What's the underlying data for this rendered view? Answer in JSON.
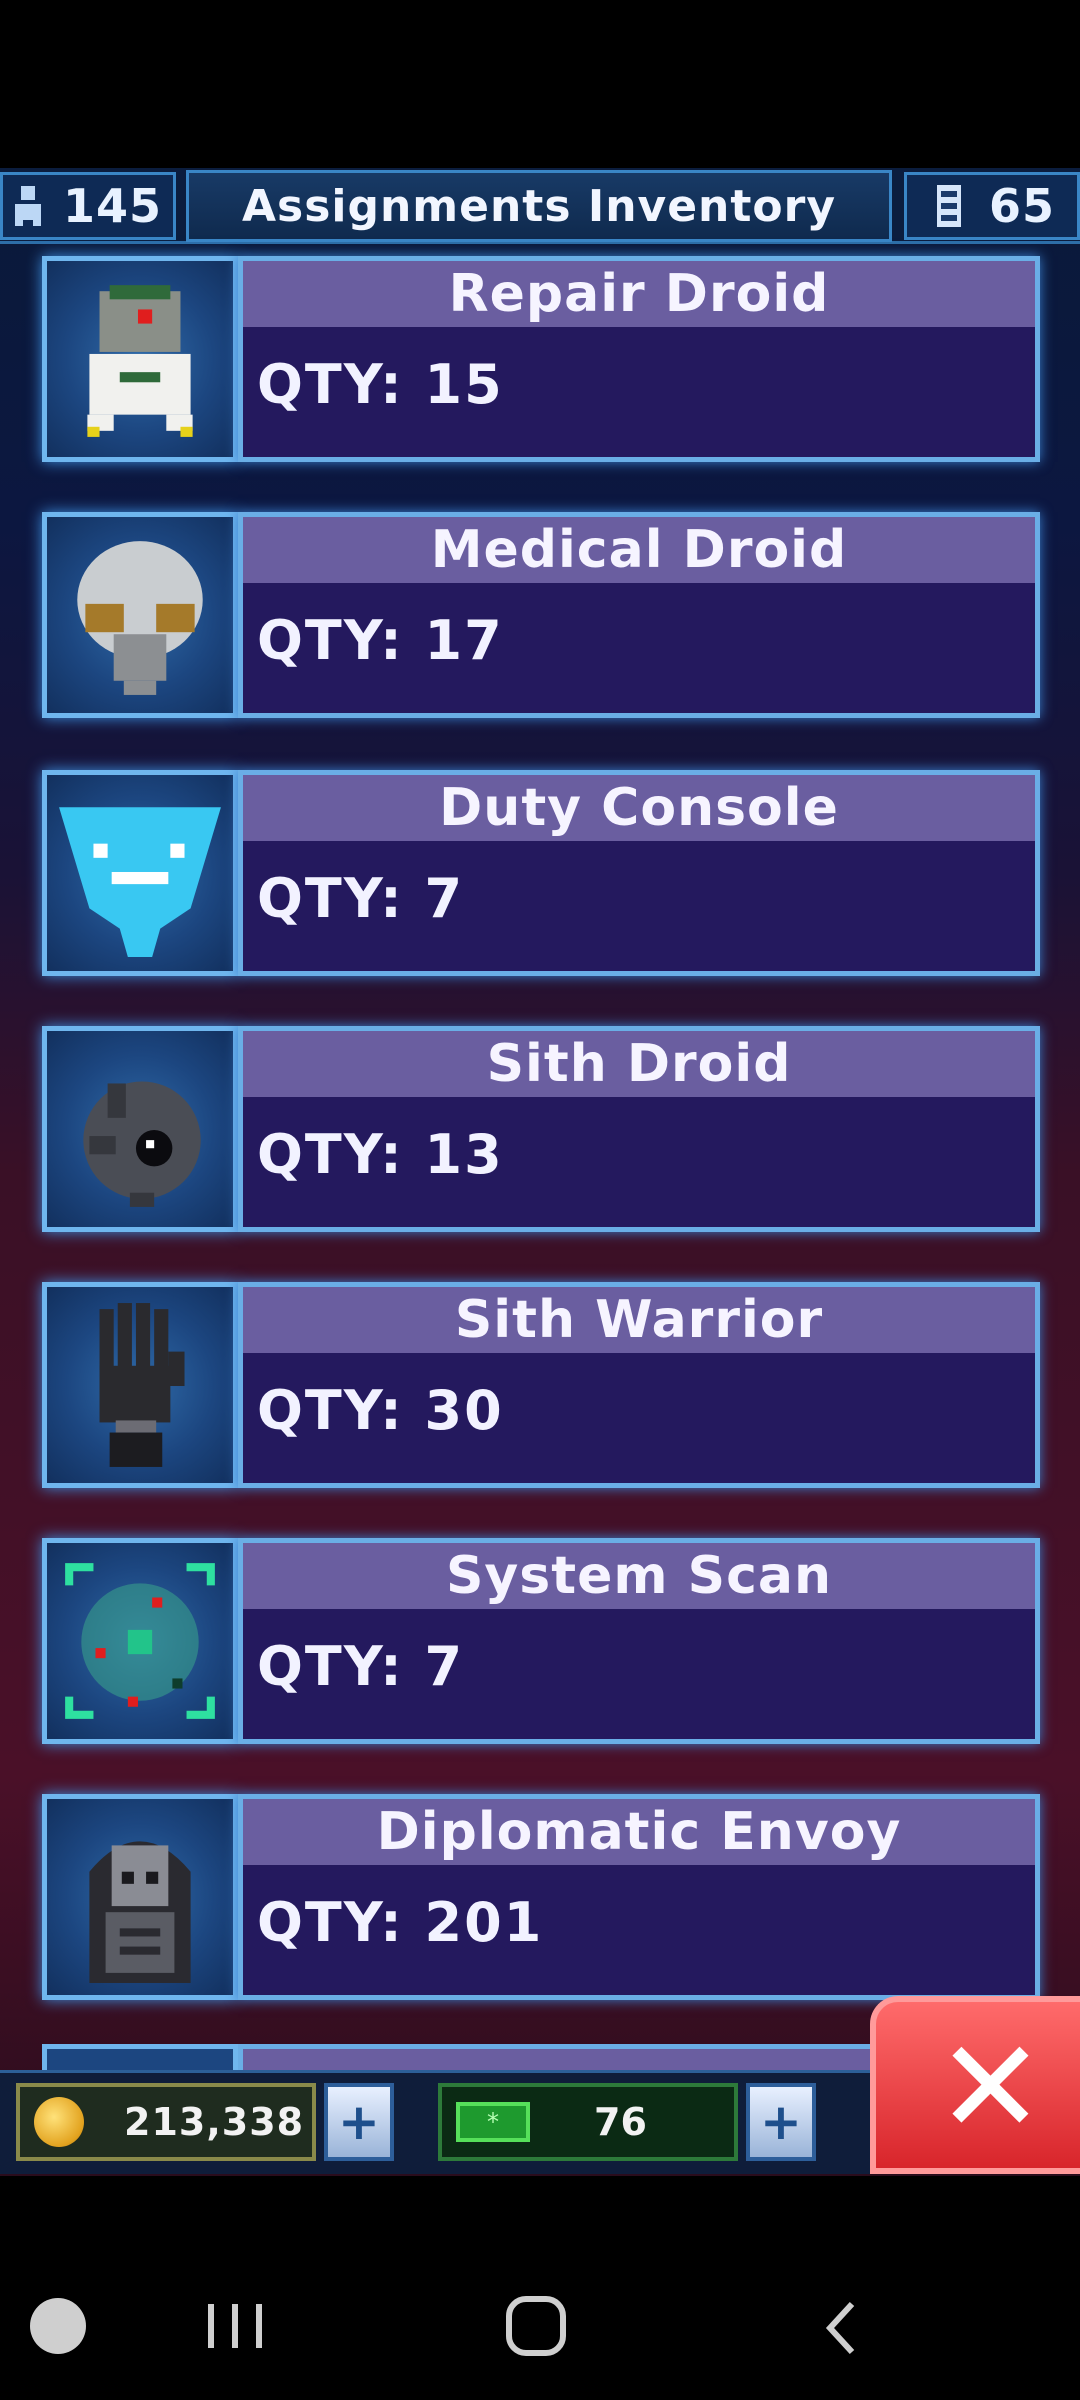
{
  "header": {
    "crew_count": "145",
    "title": "Assignments Inventory",
    "resource_count": "65"
  },
  "items": [
    {
      "name": "Repair Droid",
      "qty": "QTY: 15",
      "icon": "repair-droid-icon"
    },
    {
      "name": "Medical Droid",
      "qty": "QTY: 17",
      "icon": "medical-droid-icon"
    },
    {
      "name": "Duty Console",
      "qty": "QTY: 7",
      "icon": "duty-console-icon"
    },
    {
      "name": "Sith Droid",
      "qty": "QTY: 13",
      "icon": "sith-droid-icon"
    },
    {
      "name": "Sith Warrior",
      "qty": "QTY: 30",
      "icon": "sith-warrior-icon"
    },
    {
      "name": "System Scan",
      "qty": "QTY: 7",
      "icon": "system-scan-icon"
    },
    {
      "name": "Diplomatic Envoy",
      "qty": "QTY: 201",
      "icon": "diplomatic-envoy-icon"
    }
  ],
  "footer": {
    "credits": "213,338",
    "energy": "76",
    "plus_label": "+",
    "close_label": "✕"
  }
}
